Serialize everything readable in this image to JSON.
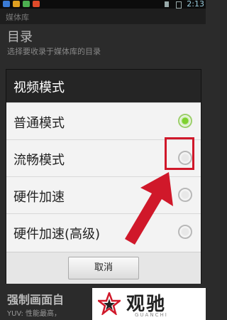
{
  "status_bar": {
    "time": "2:13"
  },
  "background": {
    "action_bar_title": "媒体库",
    "section_title": "目录",
    "section_subtitle": "选择要收录于媒体库的目录",
    "force_title": "强制画面自",
    "force_subtitle": "YUV: 性能最高，"
  },
  "dialog": {
    "title": "视频模式",
    "options": [
      {
        "label": "普通模式",
        "checked": true
      },
      {
        "label": "流畅模式",
        "checked": false
      },
      {
        "label": "硬件加速",
        "checked": false
      },
      {
        "label": "硬件加速(高级)",
        "checked": false
      }
    ],
    "cancel_label": "取消"
  },
  "watermark": {
    "name": "观驰",
    "sub": "GUANCHI"
  },
  "colors": {
    "highlight": "#d0182a",
    "radio_checked": "#7ed12f"
  }
}
